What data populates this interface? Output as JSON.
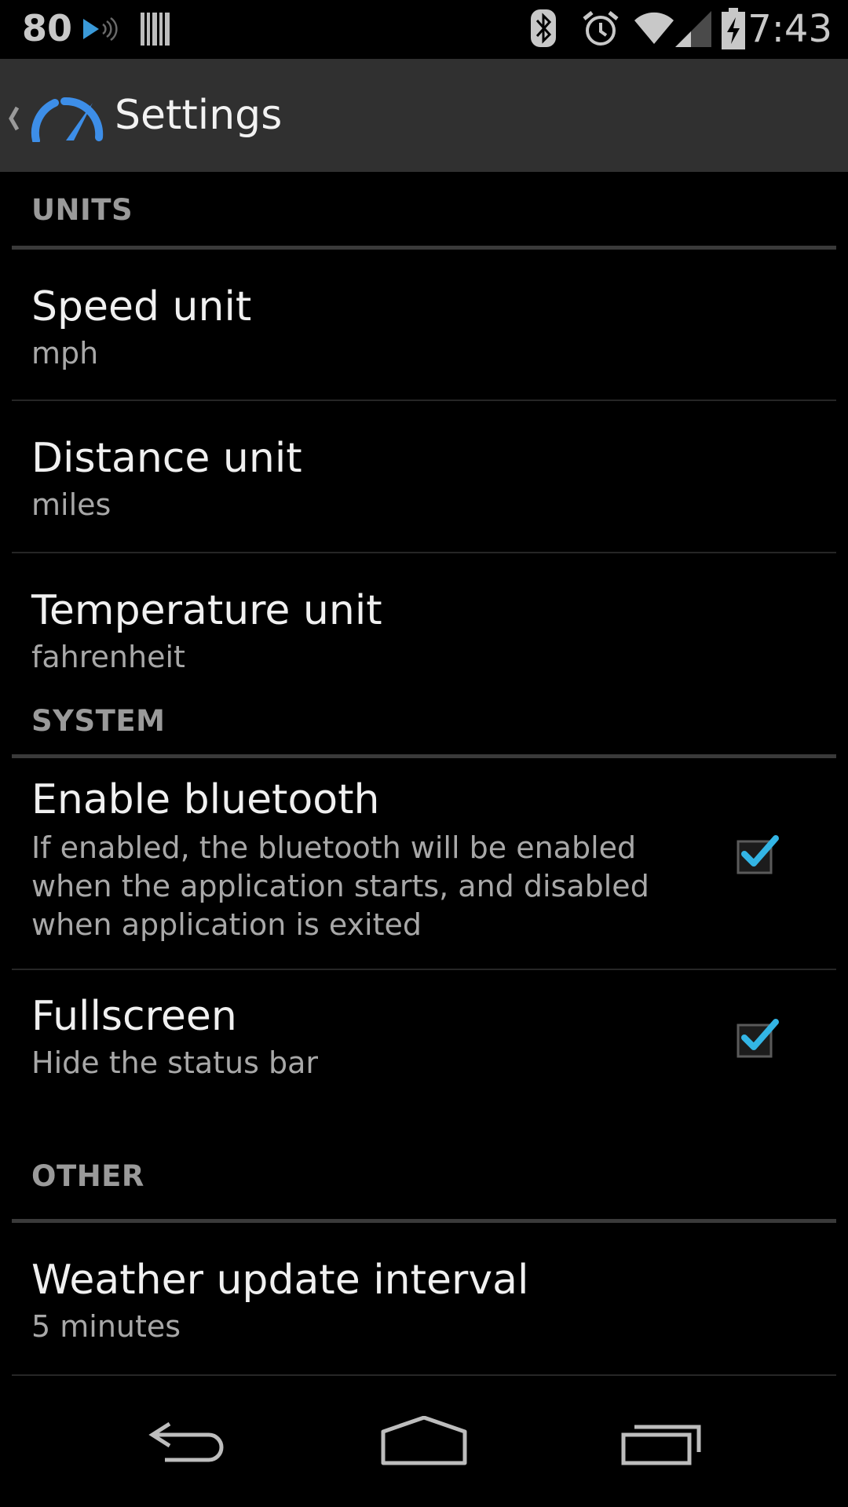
{
  "status_bar": {
    "left_number": "80",
    "time": "7:43",
    "icons": [
      "media-play-icon",
      "barcode-icon",
      "bluetooth-icon",
      "alarm-icon",
      "wifi-icon",
      "signal-icon",
      "battery-charging-icon"
    ]
  },
  "action_bar": {
    "title": "Settings",
    "icon": "speedometer-icon",
    "up_icon": "chevron-left-icon",
    "accent": "#3d8ee8"
  },
  "sections": [
    {
      "header": "UNITS",
      "items": [
        {
          "title": "Speed unit",
          "summary": "mph"
        },
        {
          "title": "Distance unit",
          "summary": "miles"
        },
        {
          "title": "Temperature unit",
          "summary": "fahrenheit"
        }
      ]
    },
    {
      "header": "SYSTEM",
      "items": [
        {
          "title": "Enable bluetooth",
          "summary_lines": [
            "If enabled, the bluetooth will be enabled",
            "when the application starts, and disabled",
            "when application is exited"
          ],
          "checked": true
        },
        {
          "title": "Fullscreen",
          "summary": "Hide the status bar",
          "checked": true
        }
      ]
    },
    {
      "header": "OTHER",
      "items": [
        {
          "title": "Weather update interval",
          "summary": "5 minutes"
        }
      ]
    }
  ],
  "colors": {
    "check_accent": "#33b5e5",
    "category_text": "#9a9a9a",
    "title_text": "#f0f0f0",
    "summary_text": "#a8a8a8"
  },
  "nav_bar": {
    "icons": [
      "back-icon",
      "home-icon",
      "recent-apps-icon"
    ]
  }
}
